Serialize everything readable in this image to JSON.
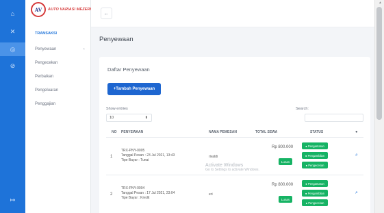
{
  "sidebar": {
    "brand": "AUTO VARIASI MEZERI",
    "logo_mark": "AV",
    "section": "TRANSAKSI",
    "items": [
      {
        "label": "Penyewaan"
      },
      {
        "label": "Pengecekan"
      },
      {
        "label": "Perbaikan"
      },
      {
        "label": "Pengeluaran"
      },
      {
        "label": "Penggajian"
      }
    ]
  },
  "page": {
    "title": "Penyewaan",
    "card_title": "Daftar Penyewaan",
    "add_button": "+Tambah Penyewaan",
    "show_entries": "Show entries",
    "entries_value": "10",
    "search_label": "Search:"
  },
  "table": {
    "headers": [
      "NO",
      "PENYEWAAN",
      "NAMA PEMESAN",
      "TOTAL SEWA",
      "STATUS"
    ],
    "rows": [
      {
        "no": "1",
        "code": "TRX-PNY-0005",
        "date": "Tanggal Pesan : 23 Jul 2021, 13:43",
        "type": "Tipe Bayar : Tunai",
        "customer": "rivaldi",
        "total": "Rp 800.000",
        "payment": "Lunas",
        "statuses": [
          "Pengantaran",
          "Pengambilan",
          "Pengecekan"
        ]
      },
      {
        "no": "2",
        "code": "TRX-PNY-0004",
        "date": "Tanggal Pesan : 17 Jul 2021, 23:04",
        "type": "Tipe Bayar : Kredit",
        "customer": "eri",
        "total": "Rp 800.000",
        "payment": "Lunas",
        "statuses": [
          "Pengantaran",
          "Pengambilan",
          "Pengecekan"
        ]
      }
    ]
  },
  "watermark": {
    "line1": "Activate Windows",
    "line2": "Go to Settings to activate Windows."
  },
  "colors": {
    "primary": "#1e73d9",
    "button": "#1e66d0",
    "success": "#16b364",
    "brand_red": "#d63b3b"
  },
  "icons": {
    "rail": [
      "home-icon",
      "tools-icon",
      "transaction-icon",
      "report-icon",
      "logout-icon"
    ],
    "back": "arrow-left-icon",
    "action": "zoom-icon",
    "check": "check-circle-icon"
  }
}
